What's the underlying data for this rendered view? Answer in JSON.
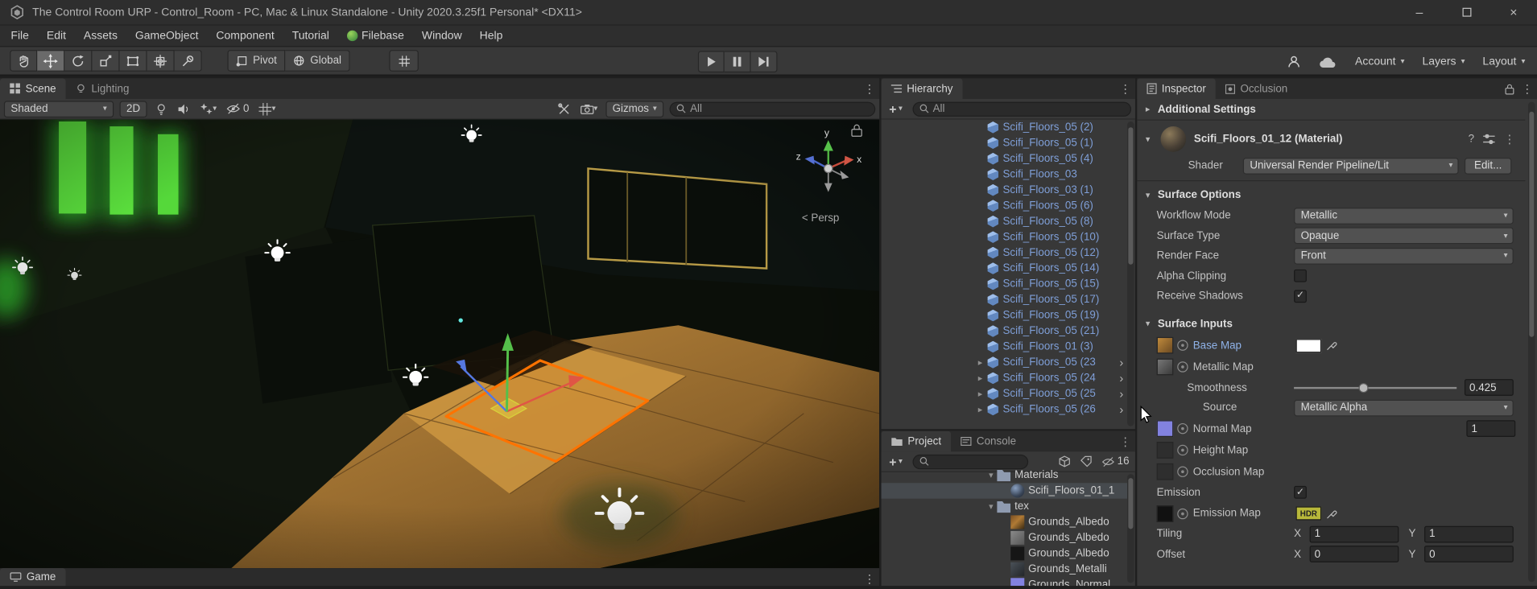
{
  "colors": {
    "panel_bg": "#383838",
    "chrome_bg": "#2e2e2e",
    "prefab_blue": "#7f9fd8",
    "selection_orange": "#ff7300",
    "green_glow": "#5ce23e",
    "floor_tan": "#c9943f",
    "hdr_badge_bg": "#b8b83a"
  },
  "icons": {
    "minimize": "–",
    "close": "×",
    "menu": "⋮",
    "dropdown": "▾",
    "foldout_open": "▾",
    "foldout_closed": "▸",
    "plus": "+",
    "check": "✓",
    "help": "?",
    "chevron_right": "›"
  },
  "title_bar": {
    "title": "The Control Room URP - Control_Room - PC, Mac & Linux Standalone - Unity 2020.3.25f1 Personal* <DX11>"
  },
  "menu_bar": {
    "items": [
      {
        "label": "File"
      },
      {
        "label": "Edit"
      },
      {
        "label": "Assets"
      },
      {
        "label": "GameObject"
      },
      {
        "label": "Component"
      },
      {
        "label": "Tutorial"
      },
      {
        "label": "Filebase",
        "icon": true
      },
      {
        "label": "Window"
      },
      {
        "label": "Help"
      }
    ]
  },
  "toolbar": {
    "pivot_label": "Pivot",
    "global_label": "Global",
    "account_label": "Account",
    "layers_label": "Layers",
    "layout_label": "Layout"
  },
  "scene": {
    "tabs": [
      {
        "label": "Scene"
      },
      {
        "label": "Lighting"
      }
    ],
    "shading_mode": "Shaded",
    "toggle_2d": "2D",
    "hidden_count": "0",
    "gizmos_label": "Gizmos",
    "search_value": "All",
    "axis_labels": {
      "x": "x",
      "y": "y",
      "z": "z"
    },
    "persp_label": "< Persp"
  },
  "game": {
    "tab_label": "Game"
  },
  "hierarchy": {
    "tab_label": "Hierarchy",
    "search_value": "All",
    "items": [
      {
        "label": "Scifi_Floors_05 (2)"
      },
      {
        "label": "Scifi_Floors_05 (1)"
      },
      {
        "label": "Scifi_Floors_05 (4)"
      },
      {
        "label": "Scifi_Floors_03"
      },
      {
        "label": "Scifi_Floors_03 (1)"
      },
      {
        "label": "Scifi_Floors_05 (6)"
      },
      {
        "label": "Scifi_Floors_05 (8)"
      },
      {
        "label": "Scifi_Floors_05 (10)"
      },
      {
        "label": "Scifi_Floors_05 (12)"
      },
      {
        "label": "Scifi_Floors_05 (14)"
      },
      {
        "label": "Scifi_Floors_05 (15)"
      },
      {
        "label": "Scifi_Floors_05 (17)"
      },
      {
        "label": "Scifi_Floors_05 (19)"
      },
      {
        "label": "Scifi_Floors_05 (21)"
      },
      {
        "label": "Scifi_Floors_01 (3)"
      },
      {
        "label": "Scifi_Floors_05 (23",
        "expand": true,
        "chevron": true
      },
      {
        "label": "Scifi_Floors_05 (24",
        "expand": true,
        "chevron": true
      },
      {
        "label": "Scifi_Floors_05 (25",
        "expand": true,
        "chevron": true
      },
      {
        "label": "Scifi_Floors_05 (26",
        "expand": true,
        "chevron": true
      }
    ]
  },
  "project": {
    "tabs": [
      {
        "label": "Project"
      },
      {
        "label": "Console"
      }
    ],
    "hidden_count": "16",
    "tree": [
      {
        "label": "Materials",
        "depth": 7,
        "open": true,
        "icon": "folder"
      },
      {
        "label": "Scifi_Floors_01_1",
        "depth": 8,
        "icon": "material",
        "selected": true
      },
      {
        "label": "tex",
        "depth": 7,
        "open": true,
        "icon": "folder"
      },
      {
        "label": "Grounds_Albedo",
        "depth": 8,
        "icon": "tex-orange"
      },
      {
        "label": "Grounds_Albedo",
        "depth": 8,
        "icon": "tex-gray"
      },
      {
        "label": "Grounds_Albedo",
        "depth": 8,
        "icon": "tex-black"
      },
      {
        "label": "Grounds_Metalli",
        "depth": 8,
        "icon": "tex-metal"
      },
      {
        "label": "Grounds_Normal",
        "depth": 8,
        "icon": "tex-normal"
      }
    ]
  },
  "inspector": {
    "tabs": [
      {
        "label": "Inspector"
      },
      {
        "label": "Occlusion"
      }
    ],
    "additional_settings_label": "Additional Settings",
    "material": {
      "name": "Scifi_Floors_01_12 (Material)",
      "shader_label": "Shader",
      "shader_value": "Universal Render Pipeline/Lit",
      "edit_button": "Edit..."
    },
    "surface_options": {
      "header": "Surface Options",
      "workflow_mode": {
        "label": "Workflow Mode",
        "value": "Metallic"
      },
      "surface_type": {
        "label": "Surface Type",
        "value": "Opaque"
      },
      "render_face": {
        "label": "Render Face",
        "value": "Front"
      },
      "alpha_clipping": {
        "label": "Alpha Clipping",
        "checked": false
      },
      "receive_shadows": {
        "label": "Receive Shadows",
        "checked": true
      }
    },
    "surface_inputs": {
      "header": "Surface Inputs",
      "base_map": {
        "label": "Base Map"
      },
      "metallic_map": {
        "label": "Metallic Map"
      },
      "smoothness": {
        "label": "Smoothness",
        "value": "0.425"
      },
      "source": {
        "label": "Source",
        "value": "Metallic Alpha"
      },
      "normal_map": {
        "label": "Normal Map",
        "value": "1"
      },
      "height_map": {
        "label": "Height Map"
      },
      "occlusion_map": {
        "label": "Occlusion Map"
      },
      "emission": {
        "label": "Emission",
        "checked": true
      },
      "emission_map": {
        "label": "Emission Map",
        "hdr_badge": "HDR"
      },
      "tiling": {
        "label": "Tiling",
        "x_label": "X",
        "x": "1",
        "y_label": "Y",
        "y": "1"
      },
      "offset": {
        "label": "Offset",
        "x_label": "X",
        "x": "0",
        "y_label": "Y",
        "y": "0"
      }
    }
  }
}
